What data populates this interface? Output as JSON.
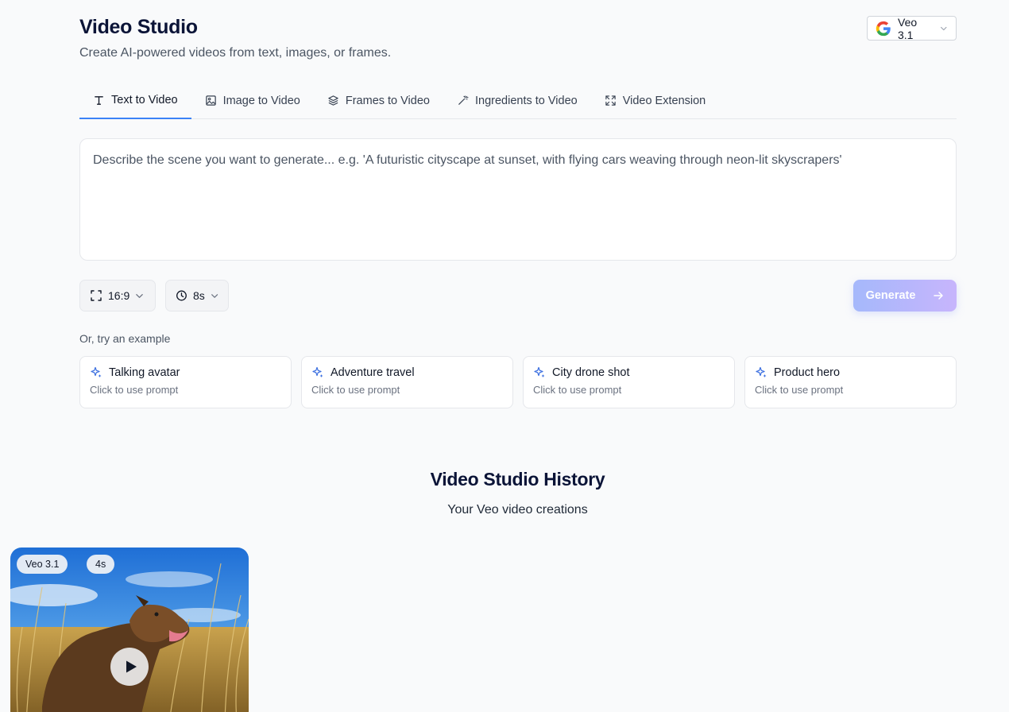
{
  "header": {
    "title": "Video Studio",
    "subtitle": "Create AI-powered videos from text, images, or frames.",
    "model_label": "Veo 3.1"
  },
  "tabs": [
    {
      "label": "Text to Video",
      "icon": "text-icon",
      "active": true
    },
    {
      "label": "Image to Video",
      "icon": "image-icon",
      "active": false
    },
    {
      "label": "Frames to Video",
      "icon": "layers-icon",
      "active": false
    },
    {
      "label": "Ingredients to Video",
      "icon": "wand-icon",
      "active": false
    },
    {
      "label": "Video Extension",
      "icon": "expand-icon",
      "active": false
    }
  ],
  "prompt": {
    "value": "",
    "placeholder": "Describe the scene you want to generate... e.g. 'A futuristic cityscape at sunset, with flying cars weaving through neon-lit skyscrapers'"
  },
  "controls": {
    "aspect_ratio": "16:9",
    "duration": "8s",
    "generate_label": "Generate"
  },
  "examples": {
    "label": "Or, try an example",
    "items": [
      {
        "title": "Talking avatar",
        "subtitle": "Click to use prompt"
      },
      {
        "title": "Adventure travel",
        "subtitle": "Click to use prompt"
      },
      {
        "title": "City drone shot",
        "subtitle": "Click to use prompt"
      },
      {
        "title": "Product hero",
        "subtitle": "Click to use prompt"
      }
    ]
  },
  "history": {
    "title": "Video Studio History",
    "subtitle": "Your Veo video creations",
    "videos": [
      {
        "model": "Veo 3.1",
        "duration": "4s"
      }
    ]
  },
  "colors": {
    "accent": "#3b82f6",
    "generate_gradient_start": "#a5b8fb",
    "generate_gradient_end": "#c7b5fc",
    "sparkle": "#3b6fe0"
  }
}
